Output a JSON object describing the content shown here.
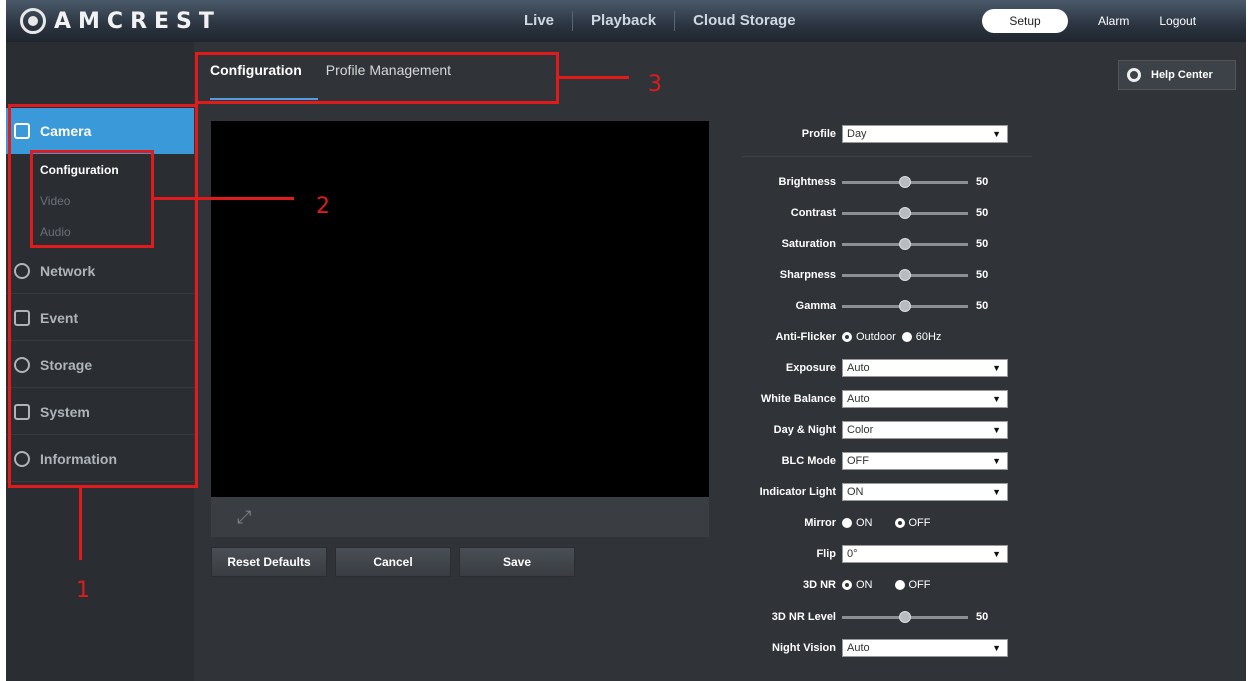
{
  "brand": {
    "name": "AMCREST"
  },
  "topnav": {
    "main": [
      "Live",
      "Playback",
      "Cloud Storage"
    ],
    "setup": "Setup",
    "alarm": "Alarm",
    "logout": "Logout"
  },
  "tabs": {
    "active": "Configuration",
    "other": "Profile Management"
  },
  "help": {
    "label": "Help Center"
  },
  "sidebar": {
    "camera": "Camera",
    "sub": [
      "Configuration",
      "Video",
      "Audio"
    ],
    "items": [
      "Network",
      "Event",
      "Storage",
      "System",
      "Information"
    ]
  },
  "buttons": {
    "reset": "Reset Defaults",
    "cancel": "Cancel",
    "save": "Save"
  },
  "form": {
    "profile": {
      "label": "Profile",
      "value": "Day"
    },
    "brightness": {
      "label": "Brightness",
      "value": "50"
    },
    "contrast": {
      "label": "Contrast",
      "value": "50"
    },
    "saturation": {
      "label": "Saturation",
      "value": "50"
    },
    "sharpness": {
      "label": "Sharpness",
      "value": "50"
    },
    "gamma": {
      "label": "Gamma",
      "value": "50"
    },
    "antiflicker": {
      "label": "Anti-Flicker",
      "opt1": "Outdoor",
      "opt2": "60Hz"
    },
    "exposure": {
      "label": "Exposure",
      "value": "Auto"
    },
    "whitebalance": {
      "label": "White Balance",
      "value": "Auto"
    },
    "daynight": {
      "label": "Day & Night",
      "value": "Color"
    },
    "blc": {
      "label": "BLC Mode",
      "value": "OFF"
    },
    "indicator": {
      "label": "Indicator Light",
      "value": "ON"
    },
    "mirror": {
      "label": "Mirror",
      "on": "ON",
      "off": "OFF"
    },
    "flip": {
      "label": "Flip",
      "value": "0°"
    },
    "nr3d": {
      "label": "3D NR",
      "on": "ON",
      "off": "OFF"
    },
    "nr3dlevel": {
      "label": "3D NR Level",
      "value": "50"
    },
    "nightvision": {
      "label": "Night Vision",
      "value": "Auto"
    }
  },
  "annotations": [
    "1",
    "2",
    "3"
  ],
  "colors": {
    "accent": "#3a9ad9",
    "annotation": "#e01b1b"
  }
}
